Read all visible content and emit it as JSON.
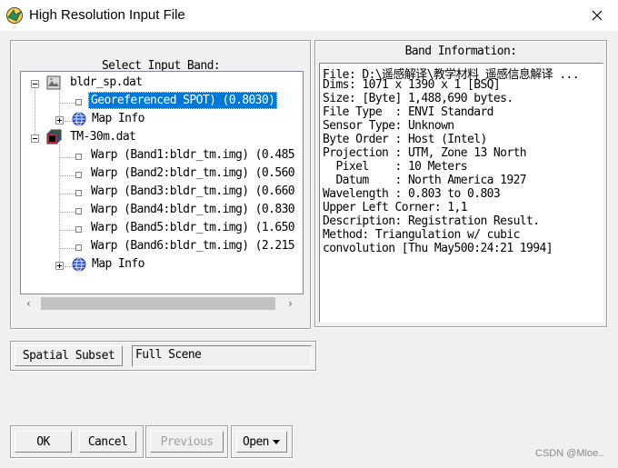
{
  "window": {
    "title": "High Resolution Input File",
    "close_glyph": "✕"
  },
  "select_band": {
    "label": "Select Input Band:",
    "tree": [
      {
        "level": 0,
        "label": "bldr_sp.dat",
        "icon": "image-file-icon",
        "toggle": "minus"
      },
      {
        "level": 1,
        "label": "Georeferenced SPOT) (0.8030)",
        "selected": true
      },
      {
        "level": 1,
        "label": "Map Info",
        "icon": "globe-icon",
        "toggle": "plus"
      },
      {
        "level": 0,
        "label": "TM-30m.dat",
        "icon": "multiband-file-icon",
        "toggle": "minus"
      },
      {
        "level": 1,
        "label": "Warp (Band1:bldr_tm.img) (0.485"
      },
      {
        "level": 1,
        "label": "Warp (Band2:bldr_tm.img) (0.560"
      },
      {
        "level": 1,
        "label": "Warp (Band3:bldr_tm.img) (0.660"
      },
      {
        "level": 1,
        "label": "Warp (Band4:bldr_tm.img) (0.830"
      },
      {
        "level": 1,
        "label": "Warp (Band5:bldr_tm.img) (1.650"
      },
      {
        "level": 1,
        "label": "Warp (Band6:bldr_tm.img) (2.215"
      },
      {
        "level": 1,
        "label": "Map Info",
        "icon": "globe-icon",
        "toggle": "plus"
      }
    ],
    "scroll_left": "‹",
    "scroll_right": "›"
  },
  "band_info": {
    "label": "Band Information:",
    "lines": [
      "File: D:\\遥感解译\\教学材料 遥感信息解译 ...",
      "Dims: 1071 x 1390 x 1 [BSQ]",
      "Size: [Byte] 1,488,690 bytes.",
      "File Type  : ENVI Standard",
      "Sensor Type: Unknown",
      "Byte Order : Host (Intel)",
      "Projection : UTM, Zone 13 North",
      "  Pixel    : 10 Meters",
      "  Datum    : North America 1927",
      "Wavelength : 0.803 to 0.803",
      "Upper Left Corner: 1,1",
      "Description: Registration Result.",
      "Method: Triangulation w/ cubic",
      "convolution [Thu May500:24:21 1994]"
    ]
  },
  "subset": {
    "button_label": "Spatial Subset",
    "value": "Full Scene"
  },
  "buttons": {
    "ok": "OK",
    "cancel": "Cancel",
    "previous": "Previous",
    "open": "Open"
  },
  "watermark": "CSDN @Mloe..",
  "colors": {
    "selection": "#0078d7",
    "dialog_bg": "#f0f0f0",
    "disabled_text": "#a0a0a0"
  }
}
